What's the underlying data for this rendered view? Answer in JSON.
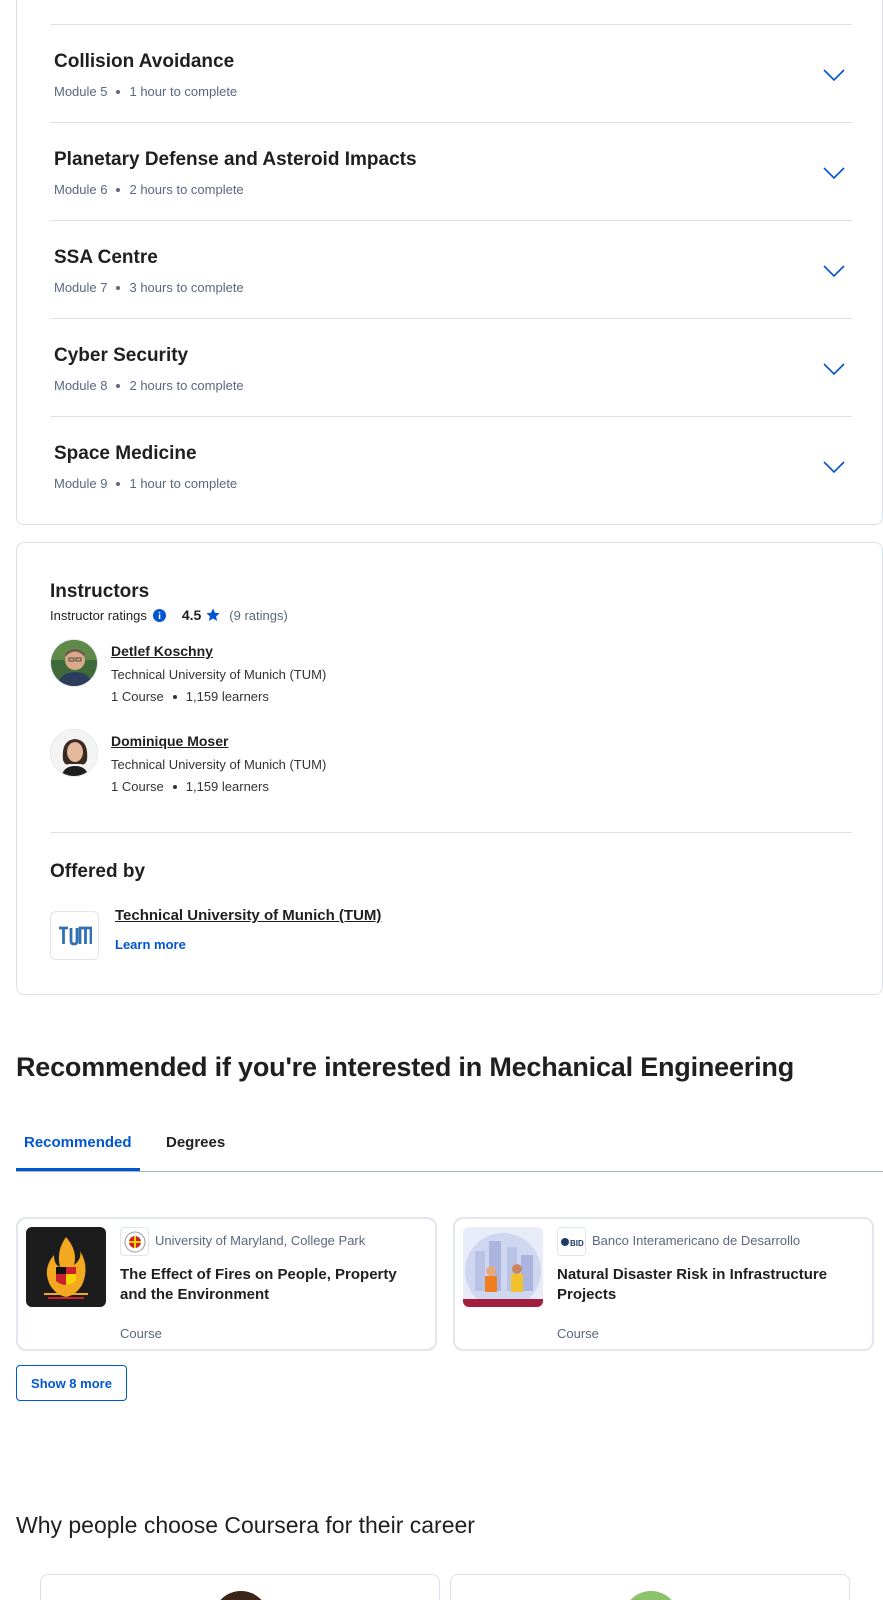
{
  "modules": [
    {
      "title": "Collision Avoidance",
      "module": "Module 5",
      "duration": "1 hour to complete"
    },
    {
      "title": "Planetary Defense and Asteroid Impacts",
      "module": "Module 6",
      "duration": "2 hours to complete"
    },
    {
      "title": "SSA Centre",
      "module": "Module 7",
      "duration": "3 hours to complete"
    },
    {
      "title": "Cyber Security",
      "module": "Module 8",
      "duration": "2 hours to complete"
    },
    {
      "title": "Space Medicine",
      "module": "Module 9",
      "duration": "1 hour to complete"
    }
  ],
  "instructors": {
    "heading": "Instructors",
    "ratings_label": "Instructor ratings",
    "rating_value": "4.5",
    "rating_count": "(9 ratings)",
    "list": [
      {
        "name": "Detlef Koschny",
        "org": "Technical University of Munich (TUM)",
        "courses": "1 Course",
        "learners": "1,159 learners"
      },
      {
        "name": "Dominique Moser",
        "org": "Technical University of Munich (TUM)",
        "courses": "1 Course",
        "learners": "1,159 learners"
      }
    ]
  },
  "offered_by": {
    "heading": "Offered by",
    "partner": "Technical University of Munich (TUM)",
    "learn_more": "Learn more"
  },
  "recommended": {
    "title": "Recommended if you're interested in Mechanical Engineering",
    "tabs": [
      "Recommended",
      "Degrees"
    ],
    "cards": [
      {
        "partner": "University of Maryland, College Park",
        "title": "The Effect of Fires on People, Property and the Environment",
        "type": "Course"
      },
      {
        "partner": "Banco Interamericano de Desarrollo",
        "title": "Natural Disaster Risk in Infrastructure Projects",
        "type": "Course"
      }
    ],
    "show_more": "Show 8 more"
  },
  "why": {
    "title": "Why people choose Coursera for their career"
  },
  "colors": {
    "accent": "#0056d2",
    "border": "#dae1ed",
    "muted_text": "#5b6780"
  }
}
